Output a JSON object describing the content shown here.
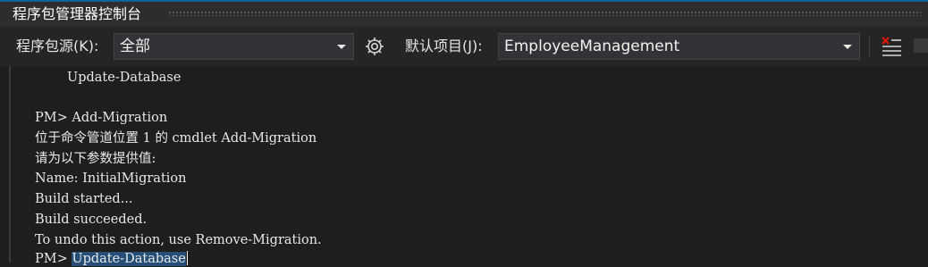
{
  "window": {
    "title": "程序包管理器控制台"
  },
  "toolbar": {
    "source_label": "程序包源(K):",
    "source_value": "全部",
    "default_project_label": "默认项目(J):",
    "default_project_value": "EmployeeManagement",
    "settings_icon": "gear-icon",
    "clear_icon": "clear-console-icon"
  },
  "console": {
    "lines": [
      "Update-Database",
      "PM> Add-Migration",
      "位于命令管道位置 1 的 cmdlet Add-Migration",
      "请为以下参数提供值:",
      "Name: InitialMigration",
      "Build started...",
      "Build succeeded.",
      "To undo this action, use Remove-Migration."
    ],
    "prompt": "PM> ",
    "current_input": "Update-Database"
  },
  "colors": {
    "background": "#1e1e1e",
    "toolbar": "#252526",
    "selection": "#264f78",
    "accent": "#0e639c"
  }
}
